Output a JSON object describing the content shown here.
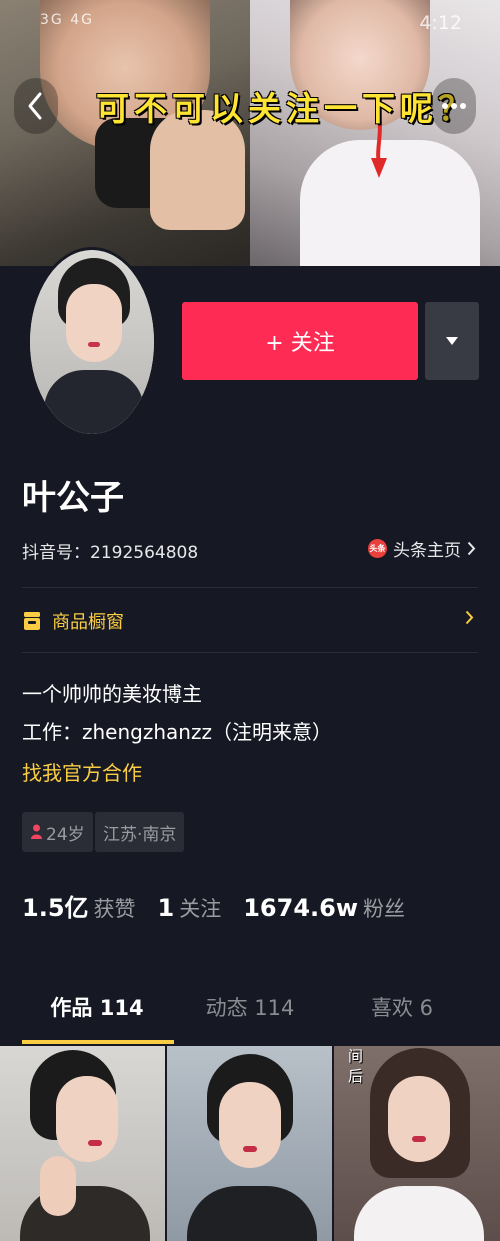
{
  "status_bar": {
    "left": "3G 4G",
    "time": "4:12"
  },
  "banner": {
    "caption": "可不可以关注一下呢？"
  },
  "profile": {
    "follow_label": "+ 关注",
    "name": "叶公子",
    "douyin_id": "抖音号：2192564808",
    "toutiao_logo_text": "头条",
    "toutiao_label": "头条主页",
    "shop_label": "商品橱窗",
    "bio": {
      "line1": "一个帅帅的美妆博主",
      "line2": "工作：zhengzhanzz（注明来意）",
      "link": "找我官方合作"
    },
    "tags": {
      "age": "24岁",
      "location": "江苏·南京"
    }
  },
  "stats": {
    "likes_num": "1.5亿",
    "likes_label": "获赞",
    "following_num": "1",
    "following_label": "关注",
    "fans_num": "1674.6w",
    "fans_label": "粉丝"
  },
  "tabs": [
    {
      "label": "作品 114",
      "active": true
    },
    {
      "label": "动态 114",
      "active": false
    },
    {
      "label": "喜欢 6",
      "active": false
    }
  ],
  "grid": {
    "cell3_text": "间后"
  },
  "colors": {
    "background": "#161823",
    "accent_red": "#fe2c55",
    "accent_yellow": "#facd44",
    "caption_yellow": "#ffe433"
  }
}
